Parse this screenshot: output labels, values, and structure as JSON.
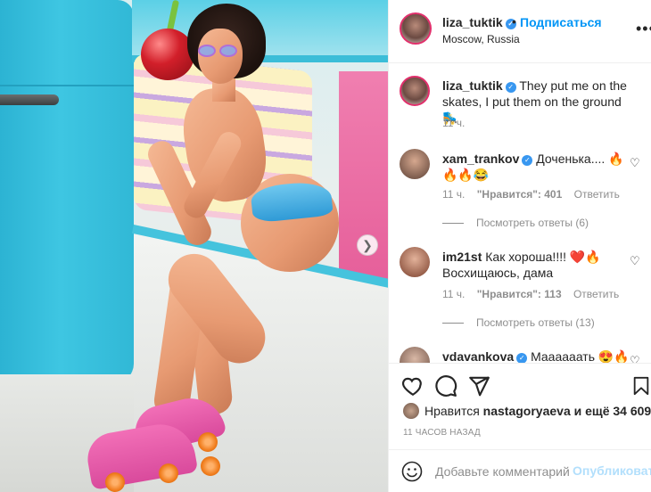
{
  "colors": {
    "accent": "#0095f6",
    "muted": "#8e8e8e",
    "text": "#262626",
    "heart": "#ed4956",
    "story_ring": "#e1306c"
  },
  "post": {
    "author": "liza_tuktik",
    "follow_label": "Подписаться",
    "location": "Moscow, Russia",
    "caption": "They put me on the skates, I put them on the ground 🛼",
    "caption_time": "11 ч."
  },
  "comments": [
    {
      "user": "xam_trankov",
      "verified": true,
      "text": "Доченька.... 🔥🔥🔥😂",
      "time": "11 ч.",
      "likes": "\"Нравится\": 401",
      "reply_label": "Ответить",
      "replies": "Посмотреть ответы (6)"
    },
    {
      "user": "im21st",
      "verified": false,
      "text": "Как хороша!!!! ❤️🔥 Восхищаюсь, дама",
      "time": "11 ч.",
      "likes": "\"Нравится\": 113",
      "reply_label": "Ответить",
      "replies": "Посмотреть ответы (13)"
    },
    {
      "user": "vdavankova",
      "verified": true,
      "text": "Маааааать 😍🔥"
    }
  ],
  "likes_summary": {
    "prefix": "Нравится",
    "user": "nastagoryaeva",
    "suffix": "и ещё 34 609"
  },
  "posted_ago": "11 ЧАСОВ НАЗАД",
  "comment_box": {
    "placeholder": "Добавьте комментарий...",
    "publish_label": "Опубликовать"
  },
  "icons": [
    "more-icon",
    "heart-icon",
    "comment-icon",
    "share-icon",
    "bookmark-icon",
    "emoji-icon",
    "next-arrow-icon",
    "verified-icon"
  ]
}
